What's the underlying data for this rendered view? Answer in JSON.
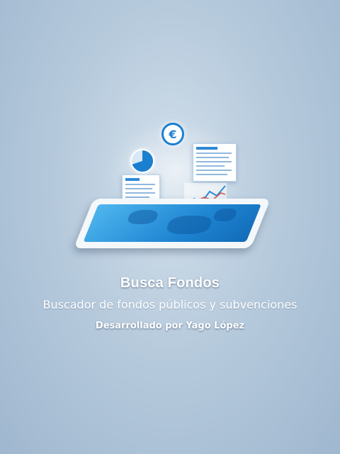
{
  "splash": {
    "title": "Busca Fondos",
    "subtitle": "Buscador de fondos públicos y subvenciones",
    "credit": "Desarrollado por Yago López"
  },
  "illustration": {
    "euro_symbol": "€",
    "icons": [
      "tablet-illustration",
      "euro-icon",
      "pie-chart-icon",
      "line-chart-icon",
      "document-panel"
    ]
  },
  "colors": {
    "background_center": "#d3e0ec",
    "background_edge": "#9fb7cf",
    "accent_blue": "#1b7fd0",
    "text": "#ffffff"
  }
}
